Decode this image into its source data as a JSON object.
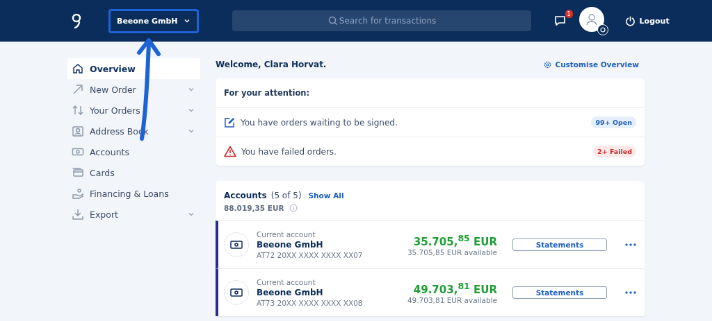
{
  "header": {
    "company": "Beeone GmbH",
    "search": {
      "placeholder": "Search for transactions"
    },
    "notifications": "1",
    "logout": "Logout"
  },
  "sidebar": {
    "items": [
      {
        "label": "Overview",
        "expandable": false,
        "selected": true
      },
      {
        "label": "New Order",
        "expandable": true,
        "selected": false
      },
      {
        "label": "Your Orders",
        "expandable": true,
        "selected": false
      },
      {
        "label": "Address Book",
        "expandable": true,
        "selected": false
      },
      {
        "label": "Accounts",
        "expandable": false,
        "selected": false
      },
      {
        "label": "Cards",
        "expandable": false,
        "selected": false
      },
      {
        "label": "Financing & Loans",
        "expandable": false,
        "selected": false
      },
      {
        "label": "Export",
        "expandable": true,
        "selected": false
      }
    ]
  },
  "welcome": "Welcome, Clara Horvat.",
  "customise": "Customise Overview",
  "attention": {
    "title": "For your attention:",
    "items": [
      {
        "kind": "sign",
        "text": "You have orders waiting to be signed.",
        "badge": "99+ Open"
      },
      {
        "kind": "failed",
        "text": "You have failed orders.",
        "badge": "2+ Failed"
      }
    ]
  },
  "accounts": {
    "title": "Accounts",
    "count": "(5 of 5)",
    "show_all": "Show All",
    "total": "88.019,35 EUR",
    "rows": [
      {
        "type": "Current account",
        "name": "Beeone GmbH",
        "iban": "AT72 20XX XXXX XXXX XX07",
        "balance": "35.705,$^{85}$ EUR",
        "available": "35.705,85 EUR available",
        "button": "Statements"
      },
      {
        "type": "Current account",
        "name": "Beeone GmbH",
        "iban": "AT73 20XX XXXX XXXX XX08",
        "balance": "49.703,$^{81}$ EUR",
        "available": "49.703,81 EUR available",
        "button": "Statements"
      }
    ]
  }
}
